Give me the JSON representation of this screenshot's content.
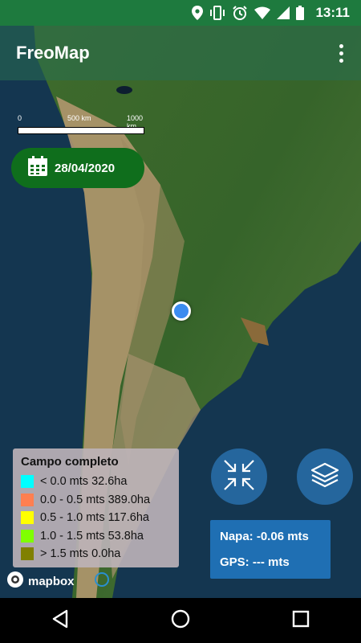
{
  "status_bar": {
    "time": "13:11",
    "icons": [
      "location-icon",
      "vibrate-icon",
      "alarm-icon",
      "wifi-icon",
      "signal-icon",
      "battery-icon"
    ]
  },
  "app_bar": {
    "title": "FreoMap",
    "menu_icon": "overflow-menu-icon"
  },
  "map": {
    "scale": {
      "labels": [
        "0",
        "500 km",
        "1000 km"
      ]
    },
    "date": "28/04/2020",
    "date_icon": "calendar-icon"
  },
  "legend": {
    "title": "Campo completo",
    "items": [
      {
        "label": "< 0.0 mts 32.6ha",
        "color": "#00ffff"
      },
      {
        "label": "0.0 - 0.5 mts 389.0ha",
        "color": "#ff7f50"
      },
      {
        "label": "0.5 - 1.0 mts 117.6ha",
        "color": "#ffff00"
      },
      {
        "label": "1.0 - 1.5 mts 53.8ha",
        "color": "#7fff00"
      },
      {
        "label": "> 1.5 mts 0.0ha",
        "color": "#808000"
      }
    ]
  },
  "attribution": {
    "logo_text": "mapbox"
  },
  "buttons": {
    "collapse_icon": "collapse-arrows-icon",
    "layers_icon": "layers-icon"
  },
  "readout": {
    "napa": "Napa: -0.06 mts",
    "gps": "GPS: --- mts"
  },
  "nav_bar": {
    "back_icon": "back-icon",
    "home_icon": "home-icon",
    "recents_icon": "recents-icon"
  }
}
